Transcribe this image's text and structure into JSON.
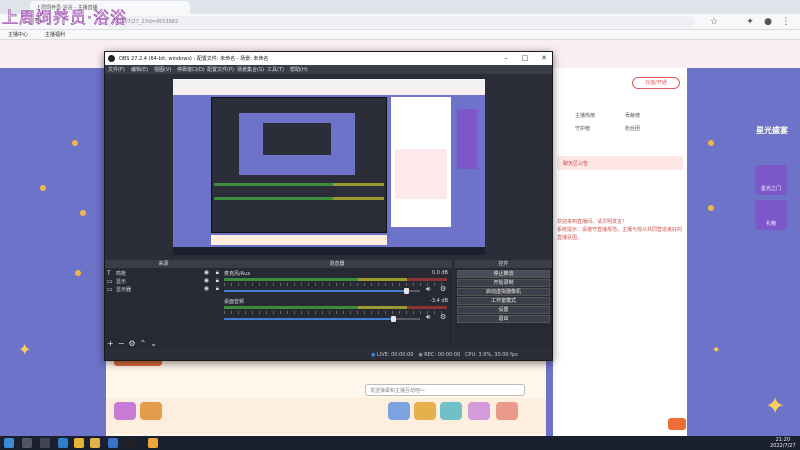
{
  "overlay_text": "上周饲养员·浴浴",
  "browser": {
    "tab_title": "上周饲养员·浴浴 - 主播直播",
    "url": "…0207/27_2?id=4553682",
    "bookmarks": [
      "主播中心",
      "主播福利"
    ]
  },
  "obs": {
    "title": "OBS 27.2.4 (64-bit, windows) - 配置文件: 未命名 - 场景: 未命名",
    "menu": [
      "文件(F)",
      "编辑(E)",
      "视图(V)",
      "停靠窗口(D)",
      "配置文件(P)",
      "场景集合(S)",
      "工具(T)",
      "帮助(H)"
    ],
    "docks": {
      "sources": "来源",
      "mixer": "混音器",
      "controls": "控件"
    },
    "sources": [
      {
        "icon": "T",
        "name": "鸣枪"
      },
      {
        "icon": "▭",
        "name": "显示"
      },
      {
        "icon": "▭",
        "name": "显示器"
      }
    ],
    "mixer": [
      {
        "name": "麦克风/Aux",
        "db": "0.0 dB",
        "level": 0.93
      },
      {
        "name": "桌面音频",
        "db": "-3.4 dB",
        "level": 0.86
      }
    ],
    "controls": [
      "停止推流",
      "开始录制",
      "启动虚拟摄像机",
      "工作室模式",
      "设置",
      "退出"
    ],
    "status": {
      "live": "LIVE: 00:00:00",
      "rec": "REC: 00:00:00",
      "cpu": "CPU: 3.9%, 30.00 fps"
    }
  },
  "page": {
    "btn_chongzhi": "充值/开通",
    "tabs": [
      "主播热榜",
      "贡献榜",
      "守护榜",
      "粉丝团"
    ],
    "chat_head": "聊天区公告",
    "chat_lines": [
      "欢迎来到直播间，请文明发言！",
      "系统提示：请遵守直播规范，主播与观众共同营造良好的直播氛围。"
    ],
    "input_placeholder": "发送弹幕和主播互动吧～",
    "badge": "星光盛宴",
    "side_items": [
      "星光之门",
      "礼物"
    ]
  },
  "taskbar": {
    "time": "21:20",
    "date": "2022/7/27"
  }
}
